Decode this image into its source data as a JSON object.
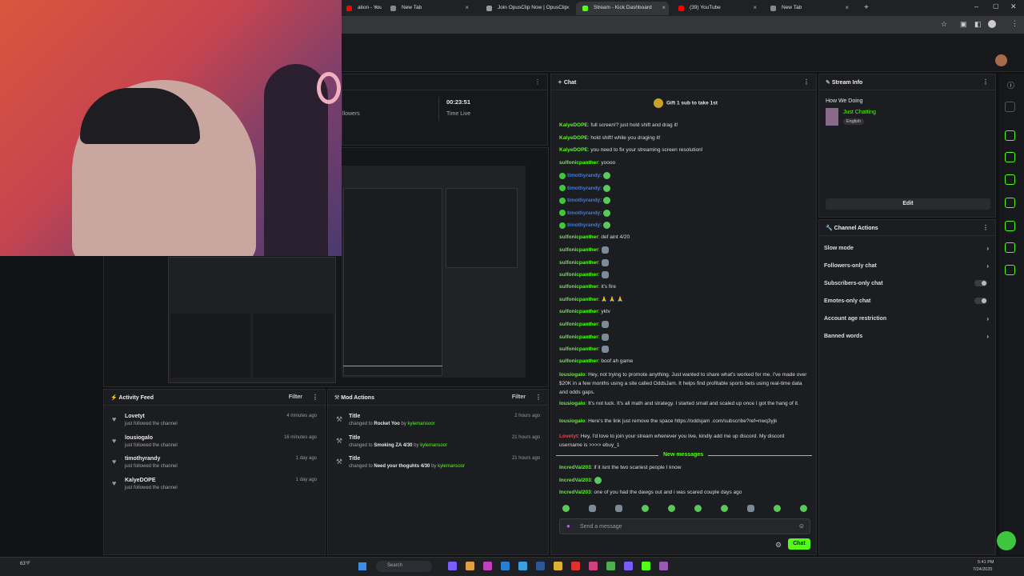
{
  "browser": {
    "tabs": [
      {
        "title": "ation - YouTu",
        "color": "#ff0000"
      },
      {
        "title": "New Tab",
        "color": "#888888"
      },
      {
        "title": "Join OpusClip Now | OpusClip",
        "color": "#999999"
      },
      {
        "title": "Stream - Kick Dashboard",
        "color": "#53fc18"
      },
      {
        "title": "(39) YouTube",
        "color": "#ff0000"
      },
      {
        "title": "New Tab",
        "color": "#888888"
      }
    ]
  },
  "stats": {
    "time_live": "00:23:51",
    "time_live_label": "Time Live",
    "followers_label": "llowers"
  },
  "activity": {
    "title": "Activity Feed",
    "filter": "Filter",
    "items": [
      {
        "name": "Lovetyt",
        "sub": "just followed the channel",
        "time": "4 minutes ago"
      },
      {
        "name": "lousiogalo",
        "sub": "just followed the channel",
        "time": "16 minutes ago"
      },
      {
        "name": "timothyrandy",
        "sub": "just followed the channel",
        "time": "1 day ago"
      },
      {
        "name": "KalyeDOPE",
        "sub": "just followed the channel",
        "time": "1 day ago"
      }
    ]
  },
  "mod": {
    "title": "Mod Actions",
    "filter": "Filter",
    "items": [
      {
        "title": "Title",
        "pre": "changed to",
        "value": "Rocket Yoo",
        "by": "by",
        "user": "kylemansoor",
        "time": "2 hours ago"
      },
      {
        "title": "Title",
        "pre": "changed to",
        "value": "Smoking ZA 4/30",
        "by": "by",
        "user": "kylemansoor",
        "time": "21 hours ago"
      },
      {
        "title": "Title",
        "pre": "changed to",
        "value": "Need your thoguhts 4/30",
        "by": "by",
        "user": "kylemansoor",
        "time": "21 hours ago"
      }
    ]
  },
  "chat": {
    "title": "Chat",
    "gift": "Gift 1 sub to take 1st",
    "new_messages": "New messages",
    "placeholder": "Send a message",
    "send": "Chat",
    "colors": {
      "kalye": "#53fc18",
      "sulf": "#53fc18",
      "timothy": "#2f7fff",
      "lous": "#53fc18",
      "lovetyt": "#ff3b3b",
      "incred": "#53fc18"
    },
    "lines": [
      {
        "user": "KalyeDOPE",
        "c": "kalye",
        "msg": ": full screen!? just hold shift and drag it!"
      },
      {
        "user": "KalyeDOPE",
        "c": "kalye",
        "msg": ": hold shift! while you draging it!"
      },
      {
        "user": "KalyeDOPE",
        "c": "kalye",
        "msg": ": you need to fix your streaming screen resolution!"
      },
      {
        "user": "sulfonicpanther",
        "c": "sulf",
        "msg": ": yoooo"
      },
      {
        "user": "timothyrandy",
        "c": "timothy",
        "msg": ":",
        "emote": "frog"
      },
      {
        "user": "timothyrandy",
        "c": "timothy",
        "msg": ":",
        "emote": "frog"
      },
      {
        "user": "timothyrandy",
        "c": "timothy",
        "msg": ":",
        "emote": "frog"
      },
      {
        "user": "timothyrandy",
        "c": "timothy",
        "msg": ":",
        "emote": "frog"
      },
      {
        "user": "timothyrandy",
        "c": "timothy",
        "msg": ":",
        "emote": "frog"
      },
      {
        "user": "sulfonicpanther",
        "c": "sulf",
        "msg": ": def aint 4/20"
      },
      {
        "user": "sulfonicpanther",
        "c": "sulf",
        "msg": ":",
        "emote": "face"
      },
      {
        "user": "sulfonicpanther",
        "c": "sulf",
        "msg": ":",
        "emote": "face"
      },
      {
        "user": "sulfonicpanther",
        "c": "sulf",
        "msg": ":",
        "emote": "face"
      },
      {
        "user": "sulfonicpanther",
        "c": "sulf",
        "msg": ": it's fire"
      },
      {
        "user": "sulfonicpanther",
        "c": "sulf",
        "msg": ": 🙏 🙏 🙏"
      },
      {
        "user": "sulfonicpanther",
        "c": "sulf",
        "msg": ": yktv"
      },
      {
        "user": "sulfonicpanther",
        "c": "sulf",
        "msg": ":",
        "emote": "face"
      },
      {
        "user": "sulfonicpanther",
        "c": "sulf",
        "msg": ":",
        "emote": "face"
      },
      {
        "user": "sulfonicpanther",
        "c": "sulf",
        "msg": ":",
        "emote": "face"
      },
      {
        "user": "sulfonicpanther",
        "c": "sulf",
        "msg": ": boof ah game"
      }
    ],
    "long": [
      {
        "user": "lousiogalo",
        "c": "lous",
        "msg": ": Hey, not trying to promote anything. Just wanted to share what's worked for me. I've made over $20K in a few months using a site called OddsJam. It helps find profitable sports bets using real-time data and odds gaps."
      },
      {
        "user": "lousiogalo",
        "c": "lous",
        "msg": ": It's not luck. It's all math and strategy. I started small and scaled up once I got the hang of it."
      },
      {
        "user": "lousiogalo",
        "c": "lous",
        "msg": ": Here's the link just remove the space https://oddsjam .com/subscribe?ref=nwq3yjk"
      },
      {
        "user": "Lovetyt",
        "c": "lovetyt",
        "msg": ": Hey, I'd love to join your stream whenever you live, kindly add me up discord. My discord username is >>>> ebuy_1"
      }
    ],
    "after": [
      {
        "user": "IncredVal203",
        "c": "incred",
        "msg": ": if it isnt the two scariest people I know"
      },
      {
        "user": "IncredVal203",
        "c": "incred",
        "msg": ":",
        "emote": "frog"
      },
      {
        "user": "IncredVal203",
        "c": "incred",
        "msg": ": one of you had the dawgs out and i was scared couple days ago"
      }
    ]
  },
  "stream_info": {
    "title": "Stream Info",
    "stream_title": "How We Doing",
    "category": "Just Chatting",
    "tag": "English",
    "edit": "Edit"
  },
  "channel_actions": {
    "title": "Channel Actions",
    "rows": [
      {
        "label": "Slow mode",
        "type": "chevron"
      },
      {
        "label": "Followers-only chat",
        "type": "chevron"
      },
      {
        "label": "Subscribers-only chat",
        "type": "toggle"
      },
      {
        "label": "Emotes-only chat",
        "type": "toggle"
      },
      {
        "label": "Account age restriction",
        "type": "chevron"
      },
      {
        "label": "Banned words",
        "type": "chevron"
      }
    ]
  },
  "taskbar": {
    "search": "Search",
    "weather": "63°F",
    "time": "5:41 PM",
    "date": "7/24/2025"
  }
}
